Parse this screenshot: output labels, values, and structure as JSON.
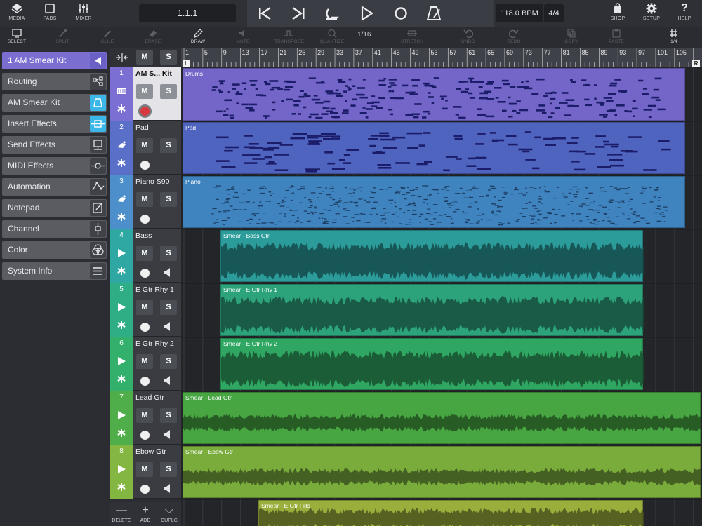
{
  "topbar": {
    "left_buttons": [
      {
        "label": "MEDIA",
        "icon": "media-icon"
      },
      {
        "label": "PADS",
        "icon": "pads-icon"
      },
      {
        "label": "MIXER",
        "icon": "mixer-icon"
      }
    ],
    "position": "1.1.1",
    "tempo": "118.0 BPM",
    "time_signature": "4/4",
    "right_buttons": [
      {
        "label": "SHOP",
        "icon": "shop-icon"
      },
      {
        "label": "SETUP",
        "icon": "gear-icon"
      },
      {
        "label": "HELP",
        "icon": "help-icon"
      }
    ]
  },
  "tools": [
    {
      "label": "SELECT",
      "icon": "select-icon",
      "active": true
    },
    {
      "label": "SPLIT",
      "icon": "split-icon",
      "active": false
    },
    {
      "label": "GLUE",
      "icon": "glue-icon",
      "active": false
    },
    {
      "label": "ERASE",
      "icon": "erase-icon",
      "active": false
    },
    {
      "label": "DRAW",
      "icon": "draw-icon",
      "active": true
    },
    {
      "label": "MUTE",
      "icon": "mute-icon",
      "active": false
    },
    {
      "label": "TRANSPOSE",
      "icon": "transpose-icon",
      "active": false
    },
    {
      "label": "QUANTIZE",
      "icon": "quantize-icon",
      "active": false
    },
    {
      "label": "STRETCH",
      "icon": "stretch-icon",
      "active": false
    },
    {
      "label": "UNDO",
      "icon": "undo-icon",
      "active": false
    },
    {
      "label": "REDO",
      "icon": "redo-icon",
      "active": false
    },
    {
      "label": "COPY",
      "icon": "copy-icon",
      "active": false
    },
    {
      "label": "PASTE",
      "icon": "paste-icon",
      "active": false
    },
    {
      "label": "1/4",
      "icon": "grid-icon",
      "active": true
    }
  ],
  "quantize_value": "1/16",
  "inspector": {
    "title": "1  AM Smear Kit",
    "items": [
      {
        "label": "Routing",
        "icon": "routing-icon"
      },
      {
        "label": "AM Smear Kit",
        "icon": "bell-icon"
      },
      {
        "label": "Insert Effects",
        "icon": "insert-icon"
      },
      {
        "label": "Send Effects",
        "icon": "send-icon"
      },
      {
        "label": "MIDI Effects",
        "icon": "midi-fx-icon"
      },
      {
        "label": "Automation",
        "icon": "automation-icon"
      },
      {
        "label": "Notepad",
        "icon": "notepad-icon"
      },
      {
        "label": "Channel",
        "icon": "channel-icon"
      },
      {
        "label": "Color",
        "icon": "color-icon"
      },
      {
        "label": "System Info",
        "icon": "menu-icon"
      }
    ]
  },
  "header_controls": {
    "mute": "M",
    "solo": "S"
  },
  "tracks": [
    {
      "number": "1",
      "name": "AM S... Kit",
      "color": "#7b6fd3",
      "type": "midi",
      "selected": true
    },
    {
      "number": "2",
      "name": "Pad",
      "color": "#5a6fc8",
      "type": "midi",
      "selected": false
    },
    {
      "number": "3",
      "name": "Piano S90",
      "color": "#4c8fca",
      "type": "midi",
      "selected": false
    },
    {
      "number": "4",
      "name": "Bass",
      "color": "#2fa8a4",
      "type": "audio",
      "selected": false
    },
    {
      "number": "5",
      "name": "E Gtr Rhy 1",
      "color": "#2fae86",
      "type": "audio",
      "selected": false
    },
    {
      "number": "6",
      "name": "E Gtr Rhy 2",
      "color": "#33b06c",
      "type": "audio",
      "selected": false
    },
    {
      "number": "7",
      "name": "Lead Gtr",
      "color": "#4fae4a",
      "type": "audio",
      "selected": false
    },
    {
      "number": "8",
      "name": "Ebow Gtr",
      "color": "#84b642",
      "type": "audio",
      "selected": false
    }
  ],
  "ruler": {
    "marks": [
      "1",
      "5",
      "9",
      "13",
      "17",
      "21",
      "25",
      "29",
      "33",
      "37",
      "41",
      "45",
      "49",
      "53",
      "57",
      "61",
      "65",
      "69",
      "73",
      "77",
      "81",
      "85",
      "89",
      "93",
      "97",
      "101",
      "105"
    ],
    "loop_left": "L",
    "loop_right": "R"
  },
  "clips": [
    {
      "name": "Drums",
      "color": "#7466c8"
    },
    {
      "name": "Pad",
      "color": "#4f64bf"
    },
    {
      "name": "Piano",
      "color": "#3f83bf"
    },
    {
      "name": "Smear - Bass Gtr",
      "color": "#2c9c9b"
    },
    {
      "name": "Smear - E Gtr Rhy 1",
      "color": "#2da37c"
    },
    {
      "name": "Smear - E Gtr Rhy 2",
      "color": "#2fa762"
    },
    {
      "name": "Smear - Lead Gtr",
      "color": "#47a542"
    },
    {
      "name": "Smear - Ebow Gtr",
      "color": "#7aac3c"
    },
    {
      "name": "Smear - E Gtr Fills",
      "color": "#9aae3c"
    }
  ],
  "bottombar": [
    {
      "label": "DELETE",
      "glyph": "—"
    },
    {
      "label": "ADD",
      "glyph": "+"
    },
    {
      "label": "DUPLC",
      "glyph": "⌵"
    }
  ]
}
